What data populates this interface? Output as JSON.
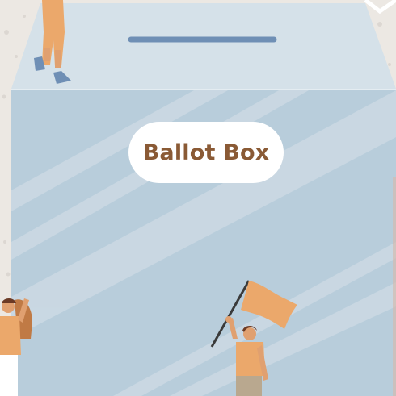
{
  "scene": {
    "title": "Ballot Box"
  },
  "colors": {
    "background": "#ece8e3",
    "box_lid": "#d5e1e9",
    "box_body": "#b8cddb",
    "box_shine": "#cddbe5",
    "slot": "#6f8fb5",
    "title_text": "#8a5a35",
    "title_pill": "#ffffff",
    "flag": "#eba86b",
    "skin": "#e0a070",
    "shirt": "#eba86b",
    "pants": "#b9a88f",
    "hair": "#6b3a25"
  },
  "icons": [
    "ballot-box-icon",
    "flag-icon",
    "person-icon"
  ]
}
